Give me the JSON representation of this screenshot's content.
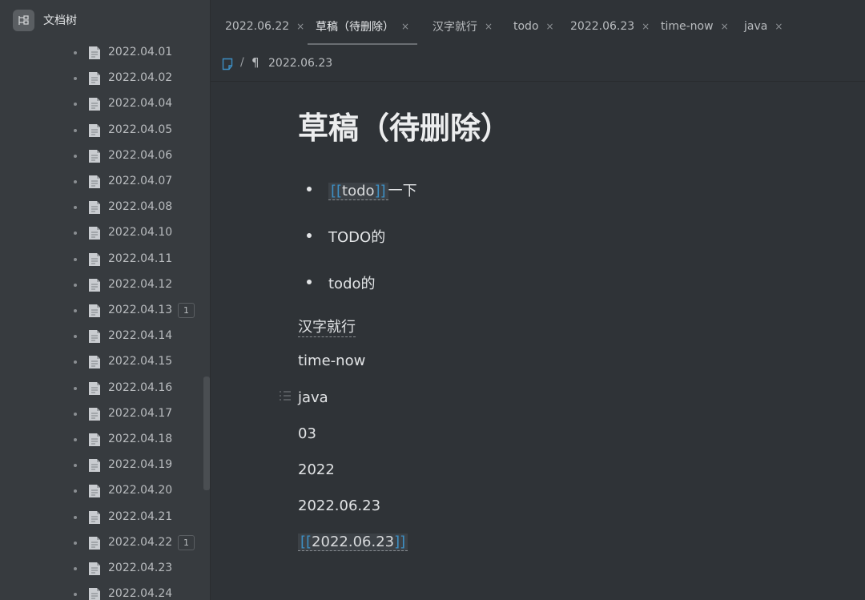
{
  "sidebar": {
    "title": "文档树",
    "logo_icon": "tree-logo-icon",
    "items": [
      {
        "label": "2022.04.01",
        "badge": ""
      },
      {
        "label": "2022.04.02",
        "badge": ""
      },
      {
        "label": "2022.04.04",
        "badge": ""
      },
      {
        "label": "2022.04.05",
        "badge": ""
      },
      {
        "label": "2022.04.06",
        "badge": ""
      },
      {
        "label": "2022.04.07",
        "badge": ""
      },
      {
        "label": "2022.04.08",
        "badge": ""
      },
      {
        "label": "2022.04.10",
        "badge": ""
      },
      {
        "label": "2022.04.11",
        "badge": ""
      },
      {
        "label": "2022.04.12",
        "badge": ""
      },
      {
        "label": "2022.04.13",
        "badge": "1"
      },
      {
        "label": "2022.04.14",
        "badge": ""
      },
      {
        "label": "2022.04.15",
        "badge": ""
      },
      {
        "label": "2022.04.16",
        "badge": ""
      },
      {
        "label": "2022.04.17",
        "badge": ""
      },
      {
        "label": "2022.04.18",
        "badge": ""
      },
      {
        "label": "2022.04.19",
        "badge": ""
      },
      {
        "label": "2022.04.20",
        "badge": ""
      },
      {
        "label": "2022.04.21",
        "badge": ""
      },
      {
        "label": "2022.04.22",
        "badge": "1"
      },
      {
        "label": "2022.04.23",
        "badge": ""
      },
      {
        "label": "2022.04.24",
        "badge": ""
      }
    ]
  },
  "tabs": [
    {
      "label": "2022.06.22",
      "close": "×",
      "active": false
    },
    {
      "label": "草稿（待删除）",
      "close": "×",
      "active": true
    },
    {
      "label": "汉字就行",
      "close": "×",
      "active": false
    },
    {
      "label": "todo",
      "close": "×",
      "active": false
    },
    {
      "label": "2022.06.23",
      "close": "×",
      "active": false
    },
    {
      "label": "time-now",
      "close": "×",
      "active": false
    },
    {
      "label": "java",
      "close": "×",
      "active": false
    }
  ],
  "breadcrumb": {
    "separator": "/",
    "pilcrow": "¶",
    "current": "2022.06.23"
  },
  "editor": {
    "title": "草稿（待删除）",
    "bullets": [
      {
        "ref_open": "[[",
        "ref_text": "todo",
        "ref_close": "]]",
        "after": "一下"
      },
      {
        "text": "TODO的"
      },
      {
        "text": "todo的"
      }
    ],
    "paragraphs": [
      "汉字就行",
      "time-now",
      "java",
      "03",
      "2022",
      "2022.06.23"
    ],
    "last_ref": {
      "open": "[[",
      "text": "2022.06.23",
      "close": "]]"
    }
  },
  "colors": {
    "background": "#2f3337",
    "sidebar": "#373b3f",
    "link_bracket": "#3d8fc4",
    "breadcrumb_icon": "#3d8fc4"
  }
}
